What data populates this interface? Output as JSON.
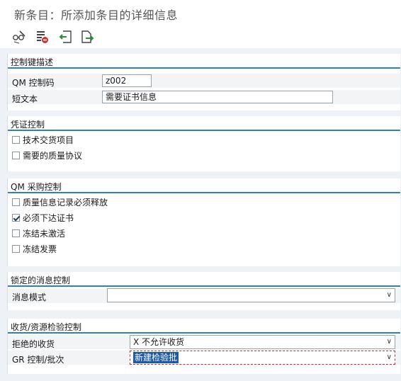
{
  "window": {
    "title": "新条目：所添加条目的详细信息"
  },
  "toolbar": {
    "buttons": [
      {
        "name": "display-change-icon"
      },
      {
        "name": "delete-icon"
      },
      {
        "name": "previous-entry-icon"
      },
      {
        "name": "next-entry-icon"
      }
    ]
  },
  "control_key": {
    "title": "控制键描述",
    "qm_key_label": "QM 控制码",
    "qm_key_value": "z002",
    "short_text_label": "短文本",
    "short_text_value": "需要证书信息"
  },
  "doc_control": {
    "title": "凭证控制",
    "tech_delivery": {
      "label": "技术交货项目",
      "checked": false
    },
    "quality_agreement": {
      "label": "需要的质量协议",
      "checked": false
    }
  },
  "qm_procurement": {
    "title": "QM 采购控制",
    "release_required": {
      "label": "质量信息记录必须释放",
      "checked": false
    },
    "certificate_required": {
      "label": "必须下达证书",
      "checked": true
    },
    "block_inactive": {
      "label": "冻结未激活",
      "checked": false
    },
    "block_invoice": {
      "label": "冻结发票",
      "checked": false
    }
  },
  "msg_control": {
    "title": "锁定的消息控制",
    "mode_label": "消息模式",
    "mode_value": ""
  },
  "gr_control": {
    "title": "收货/资源检验控制",
    "rejected_label": "拒绝的收货",
    "rejected_value": "X 不允许收货",
    "lot_label": "GR 控制/批次",
    "lot_value": "新建检验批"
  }
}
